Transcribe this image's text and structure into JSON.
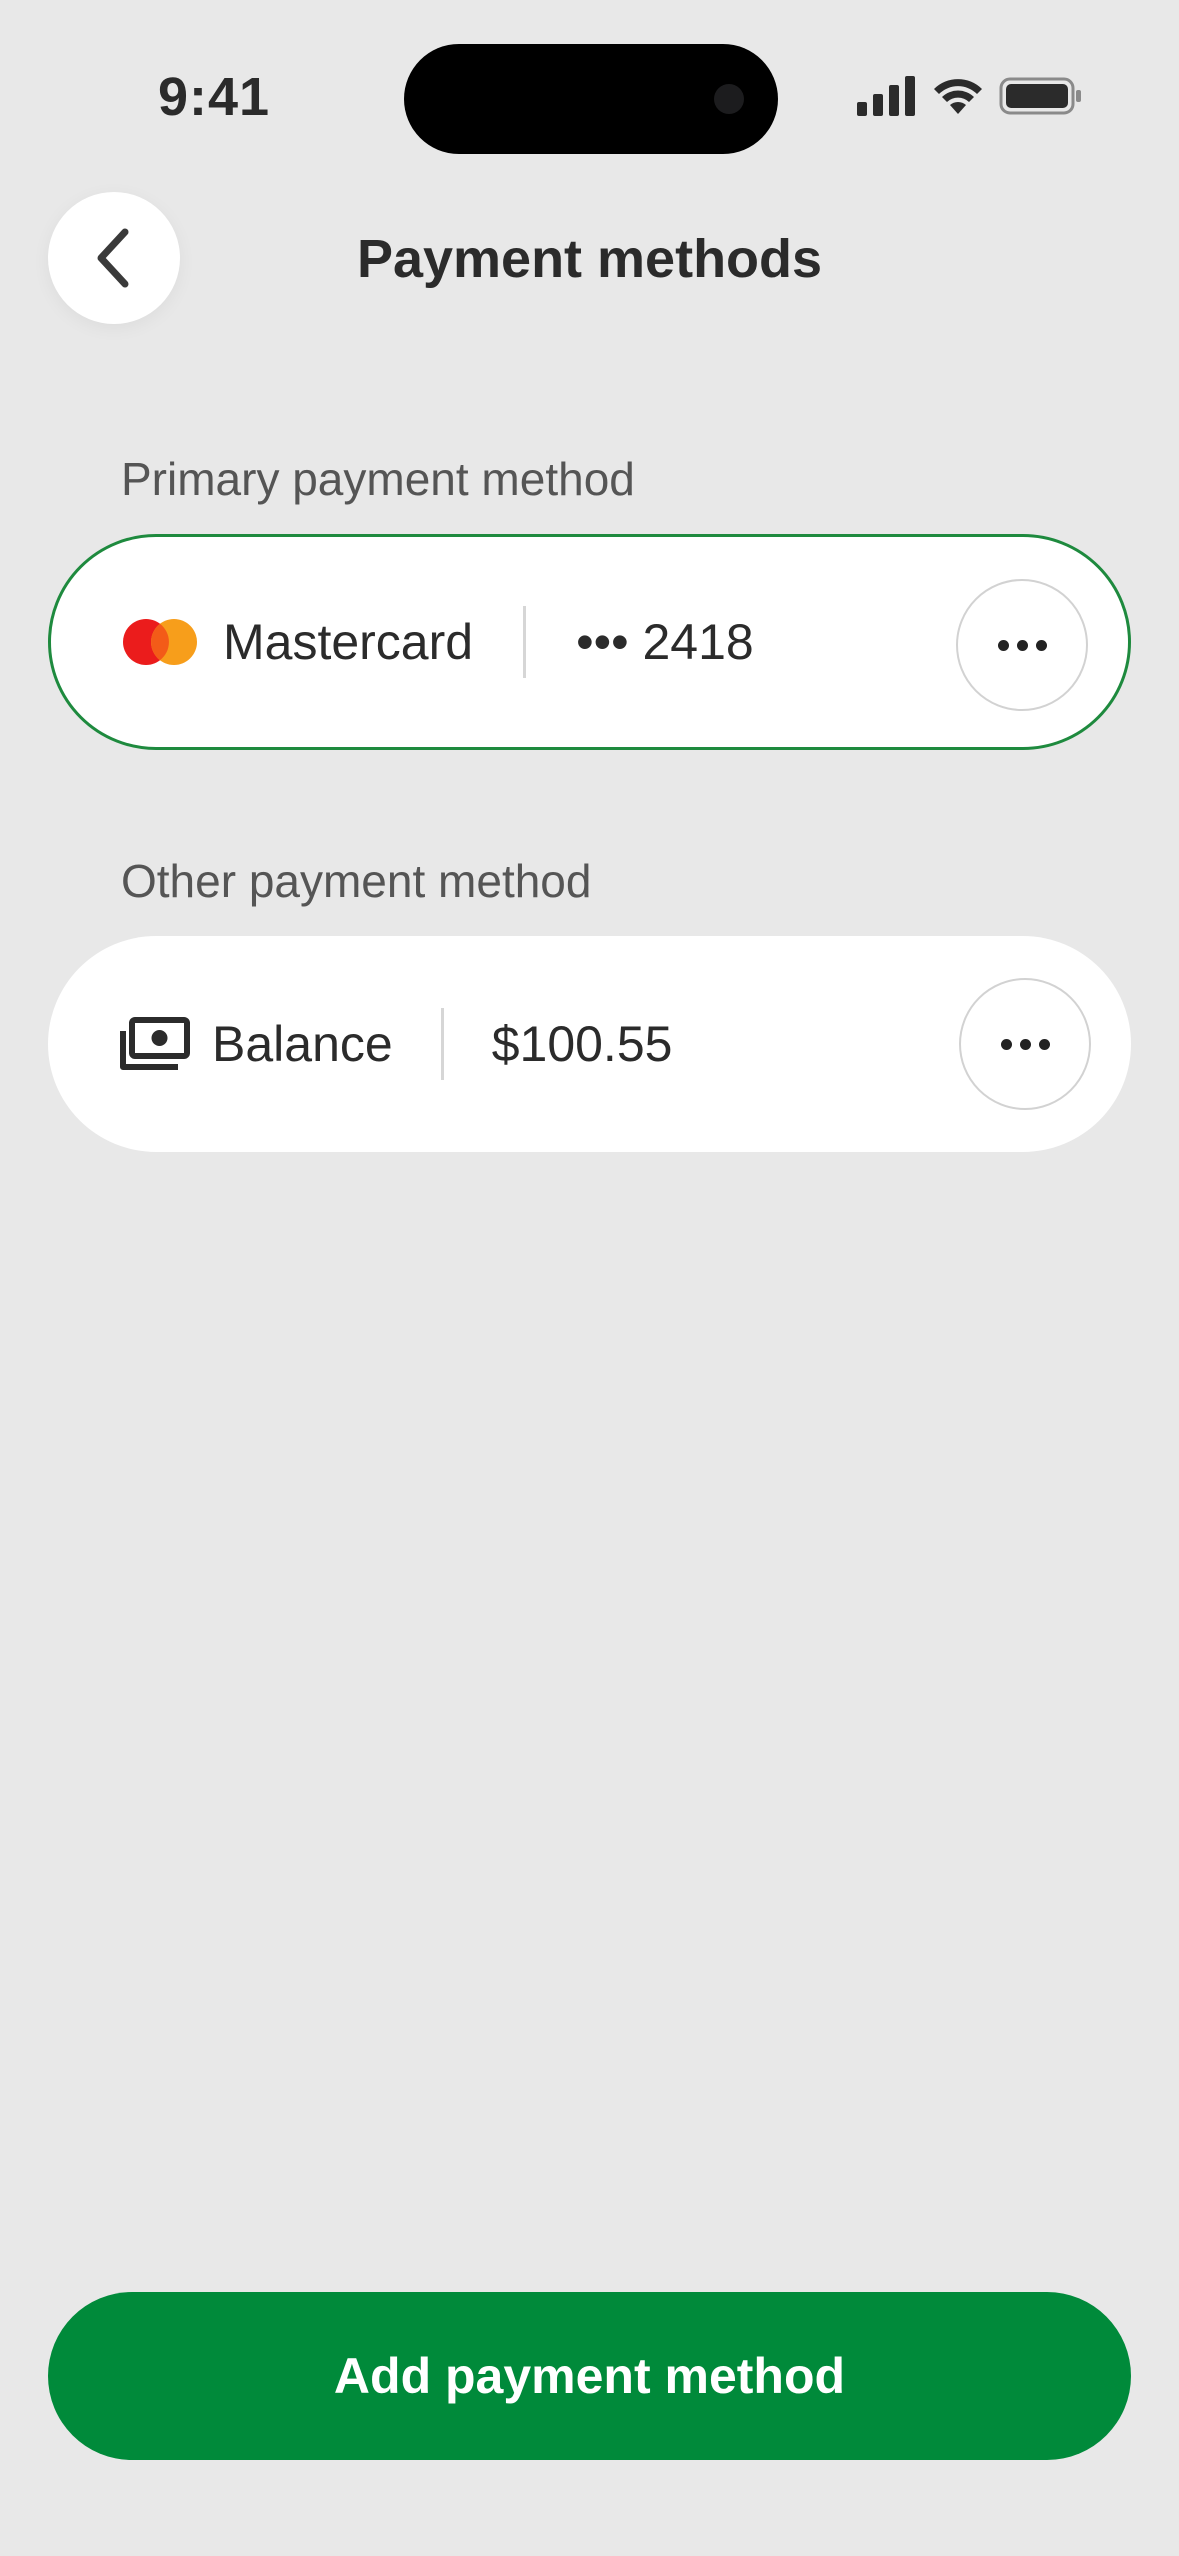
{
  "status_bar": {
    "time": "9:41"
  },
  "header": {
    "title": "Payment methods",
    "back_icon": "chevron-left-icon"
  },
  "primary_section": {
    "label": "Primary payment method",
    "card": {
      "name": "Mastercard",
      "masked_number": "••• 2418",
      "icon": "mastercard-logo-icon",
      "selected_border_color": "#1e8a3e"
    }
  },
  "other_section": {
    "label": "Other payment method",
    "card": {
      "name": "Balance",
      "value": "$100.55",
      "icon": "cash-icon"
    }
  },
  "footer": {
    "add_label": "Add payment method",
    "button_color": "#008a3a"
  },
  "colors": {
    "background": "#e8e8e8",
    "card": "#ffffff",
    "mastercard_red": "#eb1c1c",
    "mastercard_orange": "#f79e1b"
  }
}
